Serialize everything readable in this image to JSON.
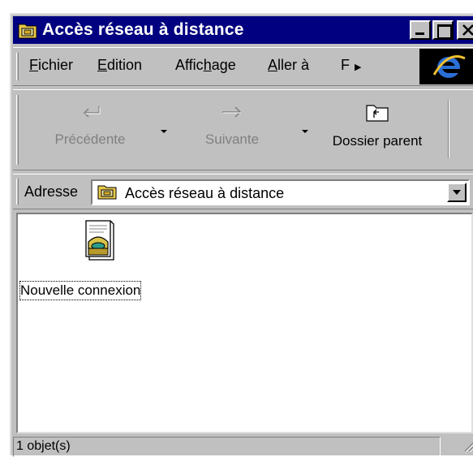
{
  "window": {
    "title": "Accès réseau à distance",
    "title_icon": "dialup-folder-icon",
    "buttons": [
      "minimize",
      "maximize",
      "close"
    ]
  },
  "menu": {
    "items": [
      {
        "label": "Fichier",
        "accel": "F"
      },
      {
        "label": "Edition",
        "accel": "E"
      },
      {
        "label": "Affichage",
        "accel": "h"
      },
      {
        "label": "Aller à",
        "accel": "A"
      },
      {
        "label": "F",
        "accel": ""
      }
    ],
    "overflow_icon": "chevron-right-icon",
    "brand_icon": "internet-explorer-icon"
  },
  "toolbar": {
    "back_label": "Précédente",
    "forward_label": "Suivante",
    "up_label": "Dossier parent"
  },
  "address": {
    "label": "Adresse",
    "value": "Accès réseau à distance"
  },
  "items": [
    {
      "label": "Nouvelle connexion",
      "icon": "make-new-connection-icon"
    }
  ],
  "status": {
    "text": "1 objet(s)"
  },
  "colors": {
    "title_bg": "#000080",
    "face": "#c0c0c0",
    "disabled_text": "#808080"
  }
}
